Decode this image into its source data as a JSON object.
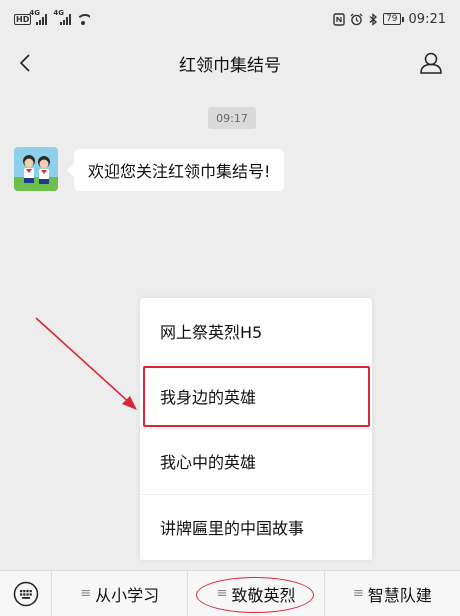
{
  "status_bar": {
    "left_badge": "HD",
    "signal_1": "4G",
    "signal_2": "4G",
    "battery": "79",
    "time": "09:21"
  },
  "header": {
    "title": "红领巾集结号",
    "back_icon": "chevron-left-icon",
    "profile_icon": "person-icon"
  },
  "chat": {
    "timestamp": "09:17",
    "message": "欢迎您关注红领巾集结号!"
  },
  "popup_menu": {
    "items": [
      {
        "label": "网上祭英烈H5"
      },
      {
        "label": "我身边的英雄"
      },
      {
        "label": "我心中的英雄"
      },
      {
        "label": "讲牌匾里的中国故事"
      }
    ],
    "highlighted_index": 1
  },
  "bottom_menu": {
    "keyboard_icon": "keyboard-icon",
    "tabs": [
      {
        "label": "从小学习"
      },
      {
        "label": "致敬英烈"
      },
      {
        "label": "智慧队建"
      }
    ],
    "tab_icon": "≡",
    "circled_tab_index": 1
  },
  "annotation_color": "#d8273b"
}
